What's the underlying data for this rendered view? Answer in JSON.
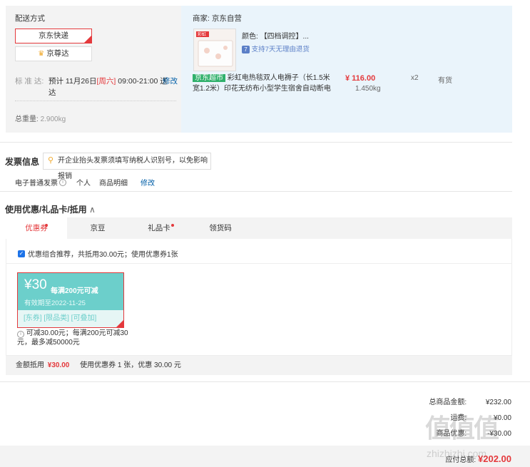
{
  "shipping": {
    "label": "配送方式",
    "option_selected": "京东快递",
    "option_other": "京尊达",
    "standard_label": "标 准 达:",
    "standard_date_prefix": "预计 11月26日",
    "standard_weekday": "[周六]",
    "standard_time": "09:00-21:00 送",
    "standard_time_line2": "达",
    "modify": "修改",
    "weight_label": "总重量:",
    "weight_value": "2.900kg"
  },
  "merchant": {
    "label": "商家:",
    "name": "京东自营",
    "product": {
      "color_label": "颜色:",
      "color_value": "【四档调控】...",
      "return_tag": "支持7天无理由退货",
      "badge": "京东超市",
      "title_line1": "彩虹电热毯双人电褥子（长1.5米",
      "title_line2": "宽1.2米）印花无纺布小型学生宿舍自动断电",
      "price": "¥ 116.00",
      "weight": "1.450kg",
      "qty": "x2",
      "stock": "有货",
      "img_brand": "彩虹"
    }
  },
  "invoice": {
    "title": "发票信息",
    "tip": "开企业抬头发票须填写纳税人识别号，以免影响报销",
    "type": "电子普通发票",
    "owner": "个人",
    "content": "商品明细",
    "modify": "修改"
  },
  "coupon": {
    "section_title": "使用优惠/礼品卡/抵用",
    "tabs": [
      {
        "label": "优惠券",
        "active": true,
        "dot": true
      },
      {
        "label": "京豆",
        "active": false,
        "dot": false
      },
      {
        "label": "礼品卡",
        "active": false,
        "dot": true
      },
      {
        "label": "领货码",
        "active": false,
        "dot": false
      }
    ],
    "recommend_text": "优惠组合推荐，共抵用30.00元；使用优惠券1张",
    "card": {
      "amount": "¥30",
      "condition": "每满200元可减",
      "validity": "有效期至2022-11-25",
      "tags": "[东券] [限品类] [可叠加]"
    },
    "note_line1": "可减30.00元；每满200元可减30",
    "note_line2": "元，最多减50000元",
    "summary_label": "金额抵用",
    "summary_amount": "¥30.00",
    "summary_desc": "使用优惠券 1 张，优惠 30.00 元"
  },
  "totals": {
    "goods_label": "总商品金额:",
    "goods_value": "¥232.00",
    "freight_label": "运费:",
    "freight_value": "¥0.00",
    "discount_label": "商品优惠:",
    "discount_value": "-¥30.00",
    "payable_label": "应付总额:",
    "payable_value": "¥202.00"
  },
  "watermark": "zhizhizhi.com",
  "colors": {
    "accent_red": "#e4393c",
    "link_blue": "#005ea7",
    "coupon_teal": "#6ccfcb",
    "jd_green": "#2fb06b"
  }
}
